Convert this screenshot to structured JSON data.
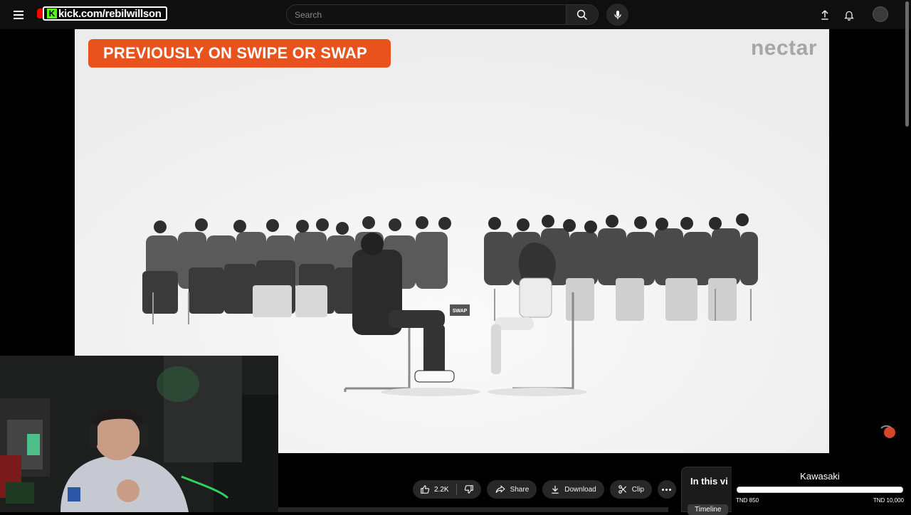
{
  "header": {
    "channel_url": "kick.com/rebilwillson",
    "search_placeholder": "Search",
    "icons": [
      "menu-icon",
      "search-icon",
      "mic-icon",
      "upload-icon",
      "bell-icon",
      "avatar"
    ]
  },
  "video": {
    "banner": "PREVIOUSLY ON SWIPE OR SWAP",
    "brand": "nectar",
    "sign_text": "SWAP"
  },
  "actions": {
    "like_count": "2.2K",
    "share": "Share",
    "download": "Download",
    "clip": "Clip"
  },
  "side_panel": {
    "title": "In this vi",
    "tab": "Timeline"
  },
  "overlay": {
    "title": "Kawasaki",
    "min_label": "TND 850",
    "max_label": "TND 10,000",
    "progress_fraction": 1.0
  },
  "colors": {
    "banner": "#e8531d",
    "kick_green": "#53fc18",
    "brand_text": "#a6a6a6",
    "background": "#0f0f0f"
  }
}
